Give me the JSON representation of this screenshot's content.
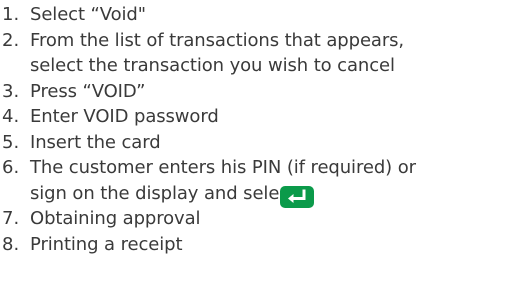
{
  "steps": [
    {
      "number": "1.",
      "lines": [
        "Select “Void\""
      ]
    },
    {
      "number": "2.",
      "lines": [
        "From the list of transactions that appears,",
        "select the transaction you wish to cancel"
      ]
    },
    {
      "number": "3.",
      "lines": [
        "Press “VOID”"
      ]
    },
    {
      "number": "4.",
      "lines": [
        "Enter VOID password"
      ]
    },
    {
      "number": "5.",
      "lines": [
        "Insert the card"
      ]
    },
    {
      "number": "6.",
      "lines": [
        "The customer enters his PIN (if required) or",
        "sign on the display and selects"
      ]
    },
    {
      "number": "7.",
      "lines": [
        "Obtaining approval"
      ]
    },
    {
      "number": "8.",
      "lines": [
        "Printing a receipt"
      ]
    }
  ],
  "icons": {
    "enter_key": "enter-key-icon",
    "enter_key_color": "#0b9a4a"
  }
}
